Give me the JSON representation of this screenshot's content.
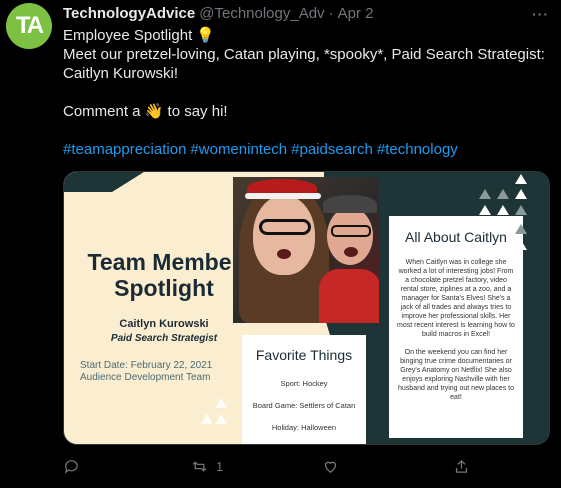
{
  "tweet": {
    "avatar_text": "TA",
    "display_name": "TechnologyAdvice",
    "handle": "@Technology_Adv",
    "separator": "·",
    "date": "Apr 2",
    "more": "···",
    "lines": {
      "l1": "Employee Spotlight 💡",
      "l2": "Meet our pretzel-loving, Catan playing, *spooky*, Paid Search Strategist:",
      "l3": "Caitlyn Kurowski!",
      "l4": "Comment a 👋 to say hi!"
    },
    "hashtags": [
      "#teamappreciation",
      "#womenintech",
      "#paidsearch",
      "#technology"
    ]
  },
  "card": {
    "title_line1": "Team Member",
    "title_line2": "Spotlight",
    "name": "Caitlyn Kurowski",
    "role": "Paid Search Strategist",
    "start_date": "Start Date: February 22, 2021",
    "team": "Audience Development Team",
    "about": {
      "title": "All About Caitlyn",
      "p1": "When Caitlyn was in college she worked a lot of interesting jobs! From a chocolate pretzel factory, video rental store, ziplines at a zoo, and a manager for Santa's Elves! She's a jack of all trades and always tries to improve her professional skills. Her most recent interest is learning how to build macros in Excel!",
      "p2": "On the weekend you can find her binging true crime documentaries or Grey's Anatomy on Netflix! She also enjoys exploring Nashville with her husband and trying out new places to eat!"
    },
    "favorites": {
      "title": "Favorite Things",
      "sport": "Sport: Hockey",
      "board_game": "Board Game: Settlers of Catan",
      "holiday": "Holiday: Halloween"
    }
  },
  "actions": {
    "retweet_count": "1"
  },
  "colors": {
    "brand_green": "#7cc142",
    "link_blue": "#1d9bf0",
    "card_teal": "#1e3538",
    "card_cream": "#fbeed0"
  }
}
